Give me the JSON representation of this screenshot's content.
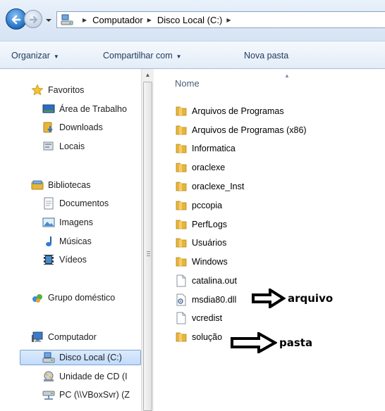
{
  "address": {
    "breadcrumbs": [
      "Computador",
      "Disco Local (C:)"
    ]
  },
  "toolbar": {
    "organize_label": "Organizar",
    "share_label": "Compartilhar com",
    "new_folder_label": "Nova pasta"
  },
  "sidebar": {
    "favorites": {
      "label": "Favoritos",
      "icon": "star-icon",
      "items": [
        {
          "label": "Área de Trabalho",
          "icon": "desktop-icon"
        },
        {
          "label": "Downloads",
          "icon": "downloads-folder-icon"
        },
        {
          "label": "Locais",
          "icon": "recent-places-icon"
        }
      ]
    },
    "libraries": {
      "label": "Bibliotecas",
      "icon": "library-icon",
      "items": [
        {
          "label": "Documentos",
          "icon": "document-icon"
        },
        {
          "label": "Imagens",
          "icon": "picture-icon"
        },
        {
          "label": "Músicas",
          "icon": "music-icon"
        },
        {
          "label": "Vídeos",
          "icon": "video-icon"
        }
      ]
    },
    "homegroup": {
      "label": "Grupo doméstico",
      "icon": "homegroup-icon"
    },
    "computer": {
      "label": "Computador",
      "icon": "computer-icon",
      "items": [
        {
          "label": "Disco Local (C:)",
          "icon": "drive-icon",
          "selected": true
        },
        {
          "label": "Unidade de CD (I",
          "icon": "cd-drive-icon"
        },
        {
          "label": "PC (\\\\VBoxSvr) (Z",
          "icon": "network-drive-icon"
        }
      ]
    }
  },
  "file_list": {
    "column_header": "Nome",
    "items": [
      {
        "name": "Arquivos de Programas",
        "type": "folder"
      },
      {
        "name": "Arquivos de Programas (x86)",
        "type": "folder"
      },
      {
        "name": "Informatica",
        "type": "folder"
      },
      {
        "name": "oraclexe",
        "type": "folder"
      },
      {
        "name": "oraclexe_Inst",
        "type": "folder"
      },
      {
        "name": "pccopia",
        "type": "folder"
      },
      {
        "name": "PerfLogs",
        "type": "folder"
      },
      {
        "name": "Usuários",
        "type": "folder"
      },
      {
        "name": "Windows",
        "type": "folder"
      },
      {
        "name": "catalina.out",
        "type": "file"
      },
      {
        "name": "msdia80.dll",
        "type": "dll"
      },
      {
        "name": "vcredist",
        "type": "file"
      },
      {
        "name": "solução",
        "type": "folder"
      }
    ]
  },
  "annotations": {
    "file_label": "arquivo",
    "folder_label": "pasta"
  },
  "colors": {
    "accent": "#1f6fc4",
    "folder": "#e8b53a",
    "selection": "#c1dbfc"
  }
}
